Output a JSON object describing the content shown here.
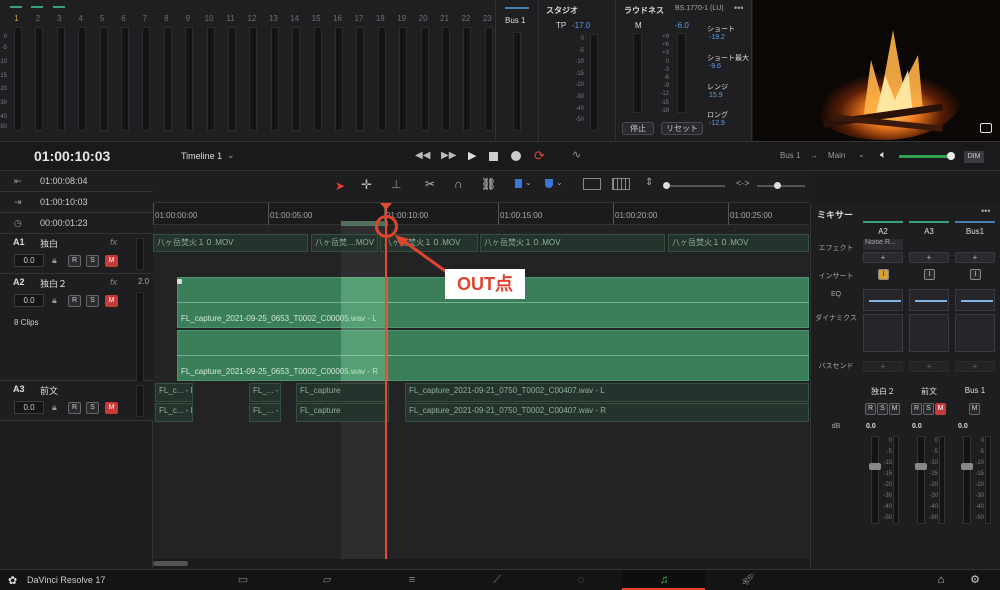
{
  "meters": {
    "numbers": [
      "1",
      "2",
      "3",
      "4",
      "5",
      "6",
      "7",
      "8",
      "9",
      "10",
      "11",
      "12",
      "13",
      "14",
      "15",
      "16",
      "17",
      "18",
      "19",
      "20",
      "21",
      "22",
      "23"
    ],
    "scale": [
      "0",
      "-5",
      "-10",
      "-15",
      "-20",
      "-30",
      "-40",
      "-50"
    ]
  },
  "bus_meter": {
    "title": "Bus 1"
  },
  "studio": {
    "title": "スタジオ",
    "tp_label": "TP",
    "tp_value": "-17.0",
    "scale": [
      "0",
      "-5",
      "-10",
      "-15",
      "-20",
      "-30",
      "-40",
      "-50"
    ]
  },
  "loudness": {
    "title": "ラウドネス",
    "standard": "BS.1770-1 (LU)",
    "more": "•••",
    "m_label": "M",
    "m_value": "-6.0",
    "scale": [
      "+9",
      "+6",
      "+3",
      "0",
      "-3",
      "-6",
      "-9",
      "-12",
      "-15",
      "-18"
    ],
    "short_label": "ショート",
    "short_value": "-19.2",
    "short_max_label": "ショート最大",
    "short_max_value": "-9.6",
    "range_label": "レンジ",
    "range_value": "15.9",
    "long_label": "ロング",
    "long_value": "-12.9",
    "stop_button": "停止",
    "reset_button": "リセット"
  },
  "toolbar": {
    "timecode": "01:00:10:03",
    "timeline_name": "Timeline 1",
    "bus_out": "Bus 1",
    "arrow": "→",
    "main_out": "Main",
    "dim_label": "DIM"
  },
  "info": {
    "rows": [
      {
        "icon": "⇤",
        "value": "01:00:08:04"
      },
      {
        "icon": "⇥",
        "value": "01:00:10:03"
      },
      {
        "icon": "◷",
        "value": "00:00:01:23"
      }
    ]
  },
  "tracks": [
    {
      "id": "A1",
      "name": "独白",
      "fx": "fx",
      "vol": "0.0",
      "extra": "",
      "clips_label": ""
    },
    {
      "id": "A2",
      "name": "独白２",
      "fx": "fx",
      "vol": "0.0",
      "extra": "2.0",
      "clips_label": "8 Clips"
    },
    {
      "id": "A3",
      "name": "前文",
      "fx": "",
      "vol": "0.0",
      "extra": "",
      "clips_label": ""
    }
  ],
  "ruler": {
    "ticks": [
      "01:00:00:00",
      "01:00:05:00",
      "01:00:10:00",
      "01:00:15:00",
      "01:00:20:00",
      "01:00:25:00"
    ]
  },
  "clips": {
    "a1": [
      "八ヶ岳焚火１０.MOV",
      "八ヶ岳焚....MOV",
      "八ヶ岳焚火１０.MOV",
      "八ヶ岳焚火１０.MOV",
      "八ヶ岳焚火１０.MOV"
    ],
    "a2": [
      "FL_capture_2021-09-25_0653_T0002_C00005.wav - L",
      "FL_capture_2021-09-25_0653_T0002_C00005.wav - R"
    ],
    "a3_l": [
      "FL_c... - L",
      "FL_... - L",
      "FL_capture",
      "FL_capture_2021-09-21_0750_T0002_C00407.wav - L"
    ],
    "a3_r": [
      "FL_c... - R",
      "FL_... - R",
      "FL_capture",
      "FL_capture_2021-09-21_0750_T0002_C00407.wav - R"
    ]
  },
  "annotation": {
    "label": "OUT点"
  },
  "mixer": {
    "title": "ミキサー",
    "more": "•••",
    "columns": [
      "A2",
      "A3",
      "Bus1"
    ],
    "effect_label": "エフェクト",
    "effect_value": "Noise R...",
    "insert_label": "インサート",
    "eq_label": "EQ",
    "dynamics_label": "ダイナミクス",
    "send_label": "バスセンド",
    "channels": [
      "独白２",
      "前文",
      "Bus 1"
    ],
    "db_label": "dB",
    "values": [
      "0.0",
      "0.0",
      "0.0"
    ],
    "scale": [
      "0",
      "-5",
      "-10",
      "-15",
      "-20",
      "-30",
      "-40",
      "-50"
    ]
  },
  "bottom": {
    "app_name": "DaVinci Resolve 17"
  },
  "colors": {
    "accent_red": "#e0442f",
    "clip_green": "#3a7f5a",
    "playhead": "#e84a2f"
  }
}
